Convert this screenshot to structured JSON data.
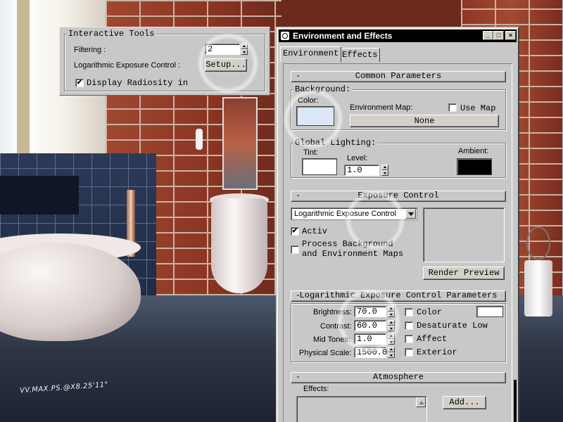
{
  "interactive_tools": {
    "title": "Interactive Tools",
    "filtering_label": "Filtering :",
    "filtering_value": "2",
    "log_exposure_label": "Logarithmic Exposure Control :",
    "setup_button": "Setup...",
    "display_radiosity_label": "Display Radiosity in",
    "display_radiosity_checked": "✔"
  },
  "window": {
    "title": "Environment and Effects",
    "tabs": [
      "Environment",
      "Effects"
    ]
  },
  "common_params": {
    "rollout_title": "Common Parameters",
    "background_group": "Background:",
    "color_label": "Color:",
    "environment_map_label": "Environment Map:",
    "use_map_label": "Use Map",
    "none_button": "None",
    "background_color": "#dce8f8",
    "global_lighting_group": "Global Lighting:",
    "tint_label": "Tint:",
    "tint_color": "#ffffff",
    "level_label": "Level:",
    "level_value": "1.0",
    "ambient_label": "Ambient:",
    "ambient_color": "#000000"
  },
  "exposure": {
    "rollout_title": "Exposure Control",
    "selected_type": "Logarithmic Exposure Control",
    "active_label": "Activ",
    "active_checked": "✔",
    "process_bg_label_1": "Process Background",
    "process_bg_label_2": "and Environment Maps",
    "render_preview_button": "Render Preview"
  },
  "log_params": {
    "rollout_title": "Logarithmic Exposure Control Parameters",
    "brightness_label": "Brightness:",
    "brightness_value": "70.0",
    "contrast_label": "Contrast:",
    "contrast_value": "60.0",
    "midtones_label": "Mid Tones:",
    "midtones_value": "1.0",
    "physical_scale_label": "Physical Scale:",
    "physical_scale_value": "1500.0",
    "color_label": "Color",
    "color_swatch": "#ffffff",
    "desaturate_label": "Desaturate Low",
    "affect_label": "Affect",
    "exterior_label": "Exterior"
  },
  "atmosphere": {
    "rollout_title": "Atmosphere",
    "effects_label": "Effects:",
    "add_button": "Add..."
  },
  "watermark": "VV.MAX.PS.@X8.25'11\""
}
